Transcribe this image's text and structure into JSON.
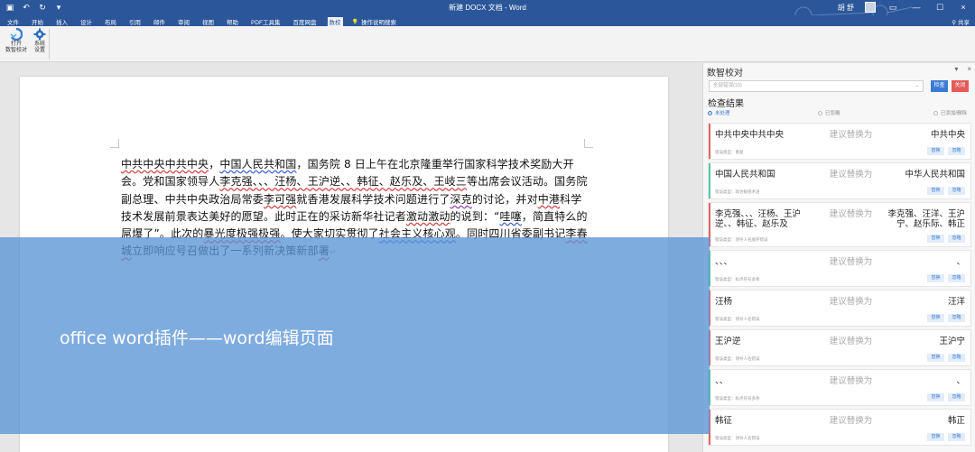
{
  "window": {
    "title": "新建 DOCX 文档 - Word",
    "user": "胡 舒",
    "share": "共享",
    "controls": [
      "—",
      "☐",
      "×"
    ]
  },
  "ribbon": {
    "tabs": [
      "文件",
      "开始",
      "插入",
      "设计",
      "布局",
      "引用",
      "邮件",
      "审阅",
      "视图",
      "帮助",
      "PDF工具集",
      "百度网盘",
      "数校"
    ],
    "active_tab": "数校",
    "tell_me": "操作说明搜索",
    "buttons": [
      {
        "label1": "打开",
        "label2": "数智校对",
        "icon": "proofread-icon"
      },
      {
        "label1": "系统",
        "label2": "设置",
        "icon": "gear-icon"
      }
    ]
  },
  "document": {
    "segments": [
      {
        "t": "中共中央中共中央",
        "u": "r"
      },
      {
        "t": "，"
      },
      {
        "t": "中国人民共和国",
        "u": "b"
      },
      {
        "t": "，国务院 8 日上午在北京隆重举行国家科学技术奖励大开会。党和国家领导人"
      },
      {
        "t": "李克强、、、汪杨、王沪逆、、韩征、赵乐及、王岐三",
        "u": "r"
      },
      {
        "t": "等出席会议活动。国务院副总理、中共中央政治局常委"
      },
      {
        "t": "李可强",
        "u": "r"
      },
      {
        "t": "就香港发展科学技术问题进行了"
      },
      {
        "t": "深克",
        "u": "p"
      },
      {
        "t": "的讨论，并对"
      },
      {
        "t": "中港",
        "u": "r"
      },
      {
        "t": "科学技术发展前景表达美好的愿望。此时正在的采访新华社记者"
      },
      {
        "t": "激动激动",
        "u": "r"
      },
      {
        "t": "的说到：“"
      },
      {
        "t": "哇噻",
        "u": "b"
      },
      {
        "t": "，简直特么的屌爆了”。此次的"
      },
      {
        "t": "暴光度极强极强",
        "u": "r"
      },
      {
        "t": "。使大家切实贯彻了"
      },
      {
        "t": "社会主义核心观",
        "u": "b"
      },
      {
        "t": "。同时四川省委副书记"
      },
      {
        "t": "李春城",
        "u": "r"
      },
      {
        "t": "立即响应号召做出了一系列新决策新部"
      },
      {
        "t": "署",
        "u": "r"
      },
      {
        "t": "↵"
      }
    ]
  },
  "panel": {
    "title": "数智校对",
    "search_placeholder": "全部错误(19)",
    "check_label": "检查",
    "close_label": "关闭",
    "results_title": "检查结果",
    "filters": [
      "未处理",
      "已忽略",
      "已添加/删除"
    ],
    "suggest_label": "建议替换为",
    "replace_label": "替换",
    "ignore_label": "忽略",
    "cards": [
      {
        "orig": "中共中央中共中央",
        "repl": "中共中央",
        "cat": "错误类型：重复",
        "color": "#e06666"
      },
      {
        "orig": "中国人民共和国",
        "repl": "中华人民共和国",
        "cat": "错误类型：政治敏感术语",
        "color": "#54c9a8"
      },
      {
        "orig": "李克强、、、汪杨、王沪逆、、韩征、赵乐及",
        "repl": "李克强、汪洋、王沪宁、赵乐际、韩正",
        "cat": "错误类型：领导人名顺序错误",
        "color": "#e06666"
      },
      {
        "orig": "、、、",
        "repl": "、",
        "cat": "错误类型：标点符号多余",
        "color": "#54c9a8"
      },
      {
        "orig": "汪杨",
        "repl": "汪洋",
        "cat": "错误类型：领导人名错误",
        "color": "#e06666"
      },
      {
        "orig": "王沪逆",
        "repl": "王沪宁",
        "cat": "错误类型：领导人名错误",
        "color": "#e06666"
      },
      {
        "orig": "、、",
        "repl": "、",
        "cat": "错误类型：标点符号多余",
        "color": "#54c9a8"
      },
      {
        "orig": "韩征",
        "repl": "韩正",
        "cat": "错误类型：领导人名错误",
        "color": "#e06666"
      }
    ]
  },
  "overlay": {
    "caption": "office word插件——word编辑页面"
  }
}
